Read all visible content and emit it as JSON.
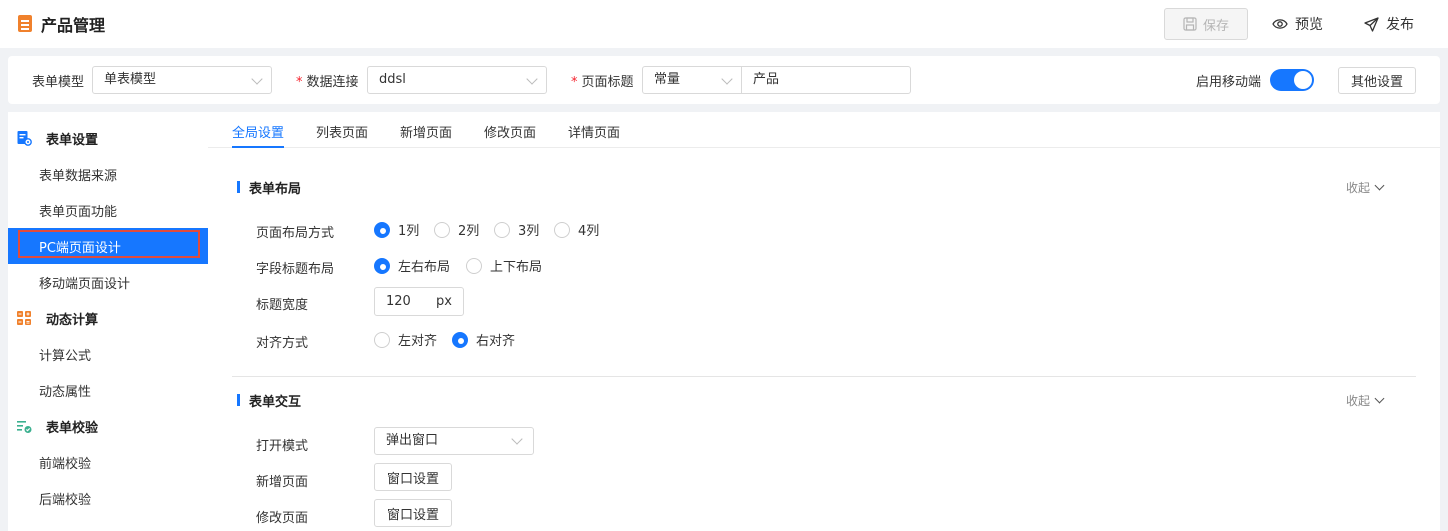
{
  "header": {
    "title": "产品管理",
    "save_label": "保存",
    "preview_label": "预览",
    "publish_label": "发布"
  },
  "config": {
    "form_model_label": "表单模型",
    "form_model_value": "单表模型",
    "data_conn_label": "数据连接",
    "data_conn_value": "ddsl",
    "page_title_label": "页面标题",
    "page_title_type": "常量",
    "page_title_value": "产品",
    "mobile_label": "启用移动端",
    "mobile_enabled": true,
    "other_settings_label": "其他设置"
  },
  "sidebar": {
    "groups": [
      {
        "label": "表单设置",
        "icon": "form-settings-icon",
        "items": [
          "表单数据来源",
          "表单页面功能",
          "PC端页面设计",
          "移动端页面设计"
        ]
      },
      {
        "label": "动态计算",
        "icon": "calculator-icon",
        "items": [
          "计算公式",
          "动态属性"
        ]
      },
      {
        "label": "表单校验",
        "icon": "checklist-icon",
        "items": [
          "前端校验",
          "后端校验"
        ]
      }
    ],
    "active_item": "PC端页面设计"
  },
  "tabs": [
    "全局设置",
    "列表页面",
    "新增页面",
    "修改页面",
    "详情页面"
  ],
  "active_tab": "全局设置",
  "layout_section": {
    "title": "表单布局",
    "collapse_label": "收起",
    "page_layout_label": "页面布局方式",
    "page_layout_options": [
      "1列",
      "2列",
      "3列",
      "4列"
    ],
    "page_layout_selected": "1列",
    "field_title_label": "字段标题布局",
    "field_title_options": [
      "左右布局",
      "上下布局"
    ],
    "field_title_selected": "左右布局",
    "title_width_label": "标题宽度",
    "title_width_value": "120",
    "title_width_unit": "px",
    "align_label": "对齐方式",
    "align_options": [
      "左对齐",
      "右对齐"
    ],
    "align_selected": "右对齐"
  },
  "interaction_section": {
    "title": "表单交互",
    "collapse_label": "收起",
    "open_mode_label": "打开模式",
    "open_mode_value": "弹出窗口",
    "new_page_label": "新增页面",
    "edit_page_label": "修改页面",
    "window_settings_label": "窗口设置"
  },
  "colors": {
    "accent": "#1677ff",
    "highlight_border": "#e04b3b",
    "app_icon": "#f0812c"
  }
}
